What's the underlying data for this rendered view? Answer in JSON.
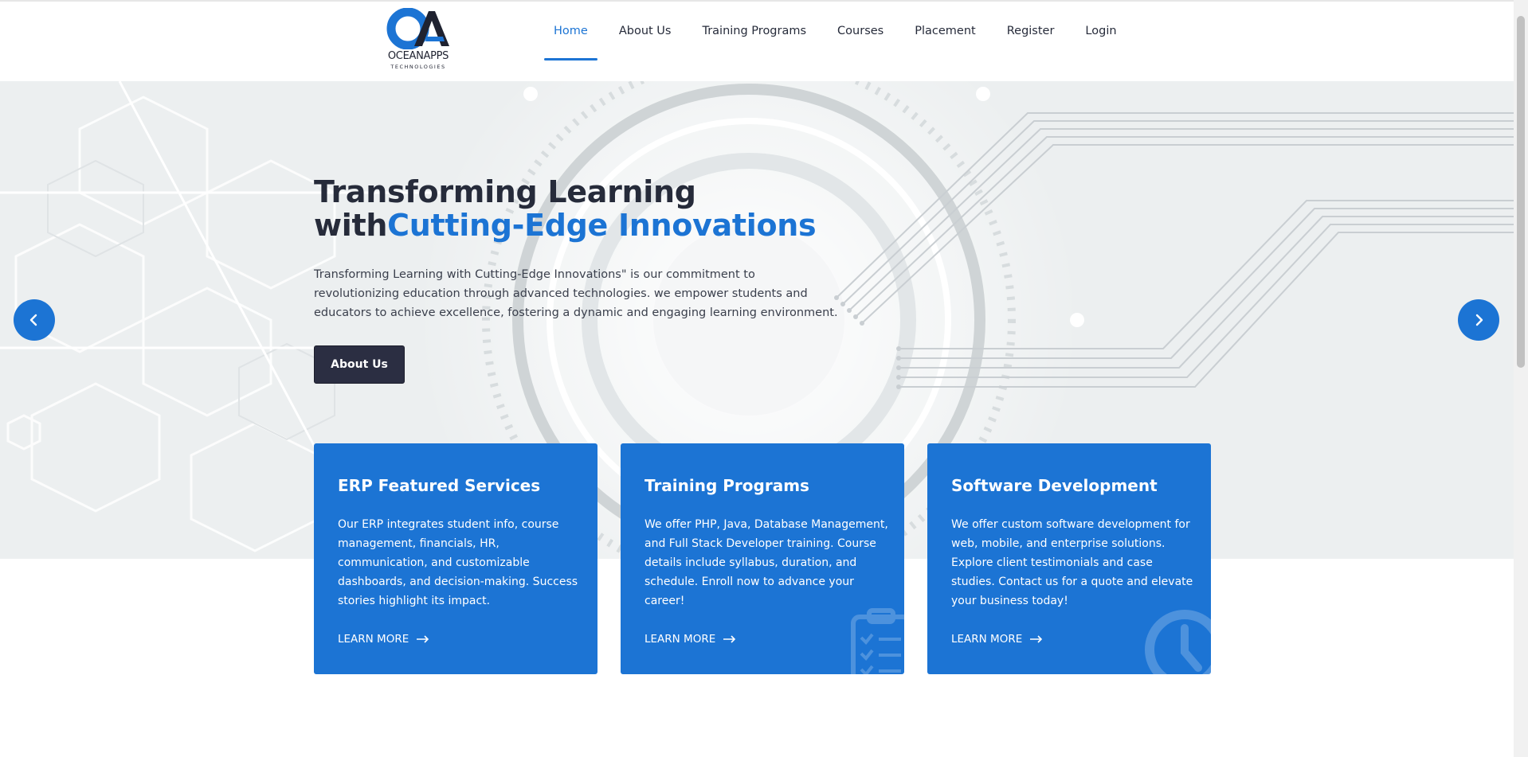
{
  "brand": {
    "name": "OCEANAPPS",
    "tagline": "TECHNOLOGIES",
    "logo_icon": "ocean-apps-logo",
    "accent_color": "#1c74d4",
    "dark_color": "#262b3a"
  },
  "nav": {
    "items": [
      {
        "label": "Home",
        "active": true
      },
      {
        "label": "About Us",
        "active": false
      },
      {
        "label": "Training Programs",
        "active": false
      },
      {
        "label": "Courses",
        "active": false
      },
      {
        "label": "Placement",
        "active": false
      },
      {
        "label": "Register",
        "active": false
      },
      {
        "label": "Login",
        "active": false
      }
    ]
  },
  "hero": {
    "title_line1": "Transforming Learning",
    "title_with": "with",
    "title_accent": "Cutting-Edge Innovations",
    "description": "Transforming Learning with Cutting-Edge Innovations\" is our commitment to revolutionizing education through advanced technologies. we empower students and educators to achieve excellence, fostering a dynamic and engaging learning environment.",
    "button_label": "About Us",
    "prev_icon": "chevron-left-icon",
    "next_icon": "chevron-right-icon"
  },
  "cards": [
    {
      "title": "ERP Featured Services",
      "text": "Our ERP integrates student info, course management, financials, HR, communication, and customizable dashboards, and decision-making. Success stories highlight its impact.",
      "link": "LEARN MORE",
      "icon": "arrow-right-icon"
    },
    {
      "title": "Training Programs",
      "text": "We offer PHP, Java, Database Management, and Full Stack Developer training. Course details include syllabus, duration, and schedule. Enroll now to advance your career!",
      "link": "LEARN MORE",
      "icon": "arrow-right-icon",
      "watermark": "clipboard-checklist-icon"
    },
    {
      "title": "Software Development",
      "text": "We offer custom software development for web, mobile, and enterprise solutions. Explore client testimonials and case studies. Contact us for a quote and elevate your business today!",
      "link": "LEARN MORE",
      "icon": "arrow-right-icon",
      "watermark": "clock-icon"
    }
  ]
}
